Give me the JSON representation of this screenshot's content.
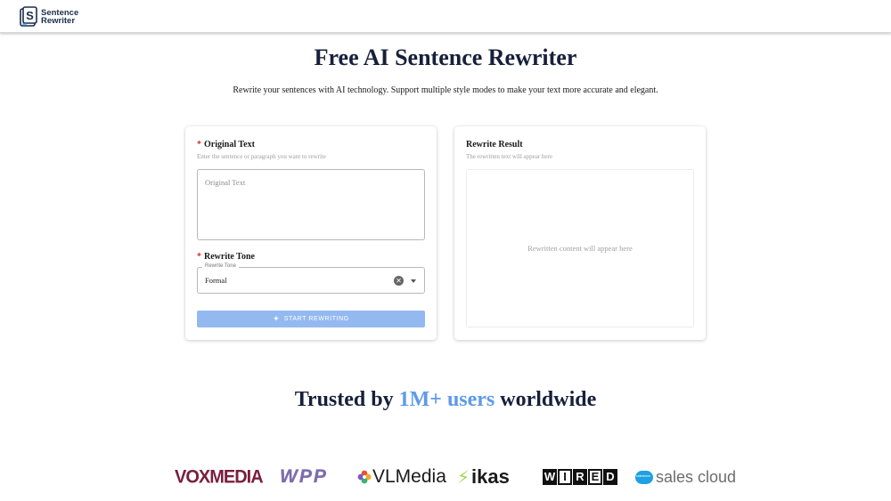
{
  "header": {
    "logo_line1": "Sentence",
    "logo_line2": "Rewriter"
  },
  "hero": {
    "title": "Free AI Sentence Rewriter",
    "subtitle": "Rewrite your sentences with AI technology. Support multiple style modes to make your text more accurate and elegant."
  },
  "input_card": {
    "required_mark": "*",
    "original_label": "Original Text",
    "original_hint": "Enter the sentence or paragraph you want to rewrite",
    "original_placeholder": "Original Text",
    "original_value": "",
    "tone_label": "Rewrite Tone",
    "tone_legend": "Rewrite Tone",
    "tone_value": "Formal",
    "clear_glyph": "✕",
    "start_button": "START REWRITING",
    "start_icon": "sparkle-icon"
  },
  "result_card": {
    "label": "Rewrite Result",
    "hint": "The rewritten text will appear here",
    "placeholder": "Rewritten content will appear here"
  },
  "trusted": {
    "prefix": "Trusted by ",
    "highlight": "1M+ users",
    "suffix": " worldwide"
  },
  "brands": {
    "vox": "VOXMEDIA",
    "wpp": "WPP",
    "vlmedia": "VLMedia",
    "ikas": "ikas",
    "wired": [
      "W",
      "I",
      "R",
      "E",
      "D"
    ],
    "salesforce": "sales cloud"
  },
  "colors": {
    "accent": "#5d9be8",
    "button": "#94b9f0",
    "required": "#d32f2f",
    "title": "#16203a"
  }
}
